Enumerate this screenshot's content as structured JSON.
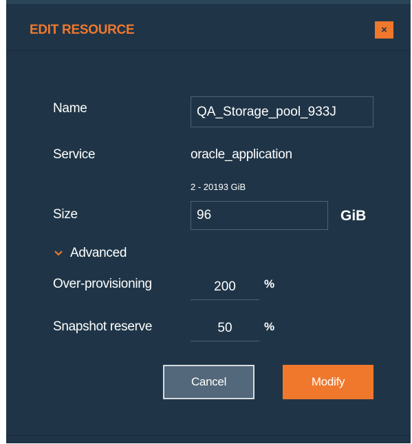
{
  "dialog": {
    "title": "EDIT RESOURCE",
    "close_label": "×"
  },
  "form": {
    "name_label": "Name",
    "name_value": "QA_Storage_pool_933J",
    "service_label": "Service",
    "service_value": "oracle_application",
    "size_hint": "2 - 20193 GiB",
    "size_label": "Size",
    "size_value": "96",
    "size_unit": "GiB",
    "advanced_label": "Advanced",
    "over_provisioning_label": "Over-provisioning",
    "over_provisioning_value": "200",
    "over_provisioning_unit": "%",
    "snapshot_reserve_label": "Snapshot reserve",
    "snapshot_reserve_value": "50",
    "snapshot_reserve_unit": "%"
  },
  "buttons": {
    "cancel_label": "Cancel",
    "modify_label": "Modify"
  },
  "icons": {
    "advanced_toggle": "chevron-down-icon",
    "close": "close-icon"
  },
  "colors": {
    "background": "#1f3547",
    "accent": "#f0782d",
    "text": "#ffffff",
    "cancel_fill": "#53687a"
  }
}
